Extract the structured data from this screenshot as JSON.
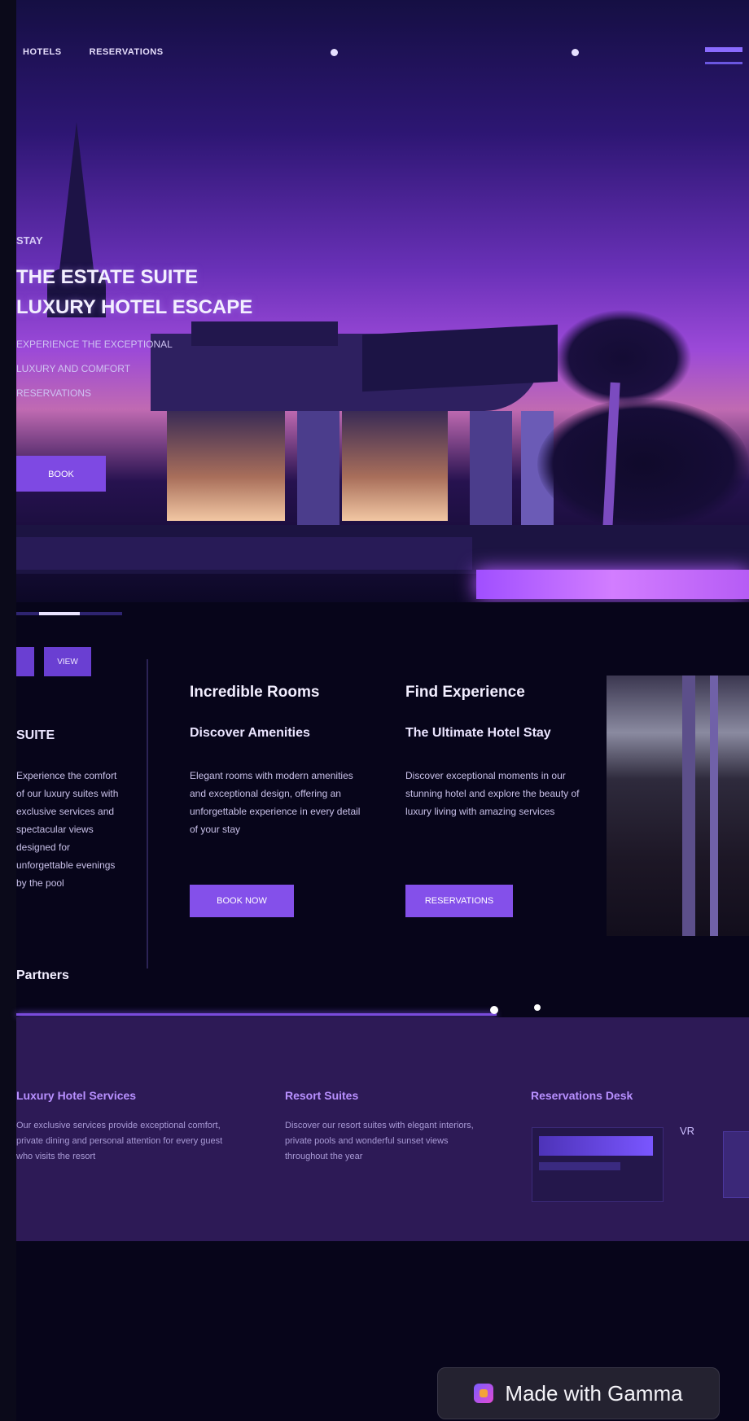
{
  "nav": {
    "item_1": "HOTELS",
    "item_2": "RESERVATIONS"
  },
  "hero": {
    "kicker": "STAY",
    "title_line_1": "THE ESTATE SUITE",
    "title_line_2": "LUXURY HOTEL ESCAPE",
    "subtitle_line_1": "EXPERIENCE THE EXCEPTIONAL",
    "subtitle_line_2": "LUXURY AND COMFORT",
    "subtitle_line_3": "RESERVATIONS",
    "cta_label": "BOOK"
  },
  "features": {
    "tab_1": "",
    "tab_2": "VIEW",
    "col1": {
      "sub": "SUITE",
      "body": "Experience the comfort of our luxury suites with exclusive services and spectacular views designed for unforgettable evenings by the pool"
    },
    "col2": {
      "heading": "Incredible Rooms",
      "sub": "Discover Amenities",
      "body": "Elegant rooms with modern amenities and exceptional design, offering an unforgettable experience in every detail of your stay",
      "button": "BOOK NOW"
    },
    "col3": {
      "heading": "Find Experience",
      "sub": "The Ultimate Hotel Stay",
      "body": "Discover exceptional moments in our stunning hotel and explore the beauty of luxury living with amazing services",
      "button": "RESERVATIONS"
    },
    "partner_label": "Partners"
  },
  "band": {
    "col1": {
      "title": "Luxury Hotel Services",
      "body": "Our exclusive services provide exceptional comfort, private dining and personal attention for every guest who visits the resort"
    },
    "col2": {
      "title": "Resort Suites",
      "body": "Discover our resort suites with elegant interiors, private pools and wonderful sunset views throughout the year"
    },
    "col3": {
      "title": "Reservations Desk"
    },
    "icon_label": "VR"
  },
  "badge": {
    "text": "Made with Gamma"
  }
}
